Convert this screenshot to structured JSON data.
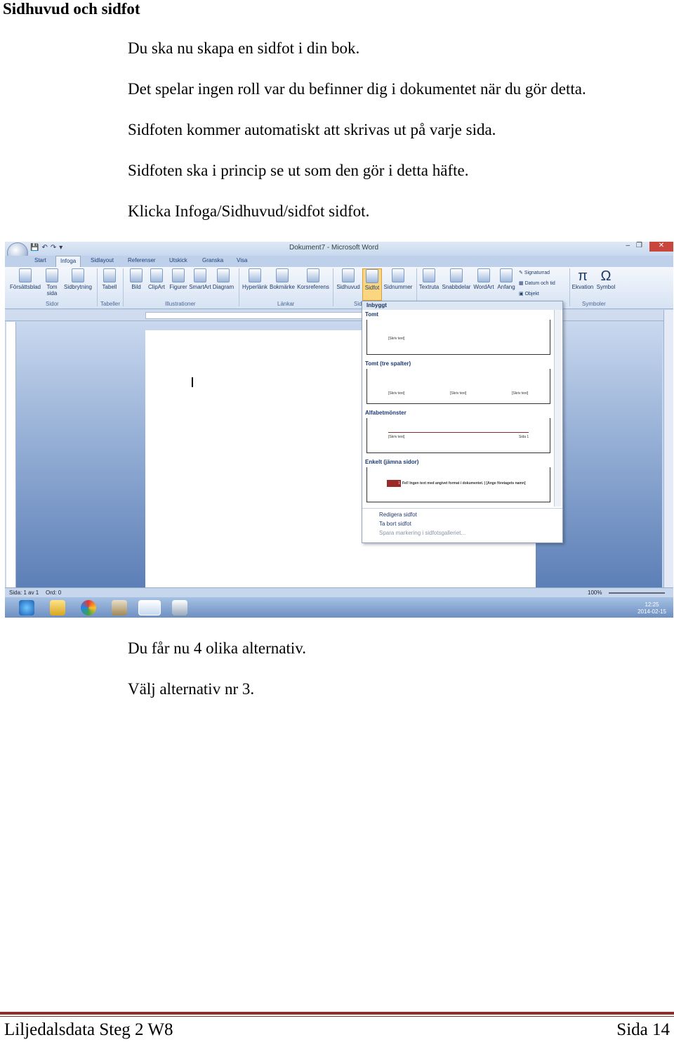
{
  "heading": "Sidhuvud och sidfot",
  "paragraphs_top": [
    "Du ska nu skapa en sidfot i din bok.",
    "Det spelar ingen roll var du befinner dig i dokumentet när du gör detta.",
    "Sidfoten kommer automatiskt att skrivas ut på varje sida.",
    "Sidfoten ska i princip se ut som den gör i detta häfte.",
    "Klicka Infoga/Sidhuvud/sidfot sidfot."
  ],
  "paragraphs_bottom": [
    "Du får nu 4 olika alternativ.",
    "Välj alternativ nr 3."
  ],
  "footer": {
    "left": "Liljedalsdata Steg 2 W8",
    "right": "Sida 14"
  },
  "word": {
    "window_title": "Dokument7 - Microsoft Word",
    "tabs": [
      "Start",
      "Infoga",
      "Sidlayout",
      "Referenser",
      "Utskick",
      "Granska",
      "Visa"
    ],
    "active_tab": "Infoga",
    "ribbon_buttons": [
      "Försättsblad",
      "Tom sida",
      "Sidbrytning",
      "Tabell",
      "Bild",
      "ClipArt",
      "Figurer",
      "SmartArt",
      "Diagram",
      "Hyperlänk",
      "Bokmärke",
      "Korsreferens",
      "Sidhuvud",
      "Sidfot",
      "Sidnummer",
      "Textruta",
      "Snabbdelar",
      "WordArt",
      "Anfang",
      "Ekvation",
      "Symbol"
    ],
    "ribbon_small": [
      "Signaturrad",
      "Datum och tid",
      "Objekt"
    ],
    "groups": [
      "Sidor",
      "Tabeller",
      "Illustrationer",
      "Länkar",
      "Sid",
      "Symboler"
    ],
    "gallery": {
      "header": "Inbyggt",
      "sections": [
        "Tomt",
        "Tomt (tre spalter)",
        "Alfabetmönster",
        "Enkelt (jämna sidor)"
      ],
      "placeholder": "[Skriv text]",
      "page_label": "Sida 1",
      "enkelt_text": "Fel! Ingen text med angivet format i dokumentet. | [Ange företagets namn]",
      "enkelt_num": "1",
      "menu": [
        "Redigera sidfot",
        "Ta bort sidfot",
        "Spara markering i sidfotsgalleriet..."
      ]
    },
    "status": {
      "page": "Sida: 1 av 1",
      "words": "Ord: 0",
      "zoom": "100%"
    },
    "clock": {
      "time": "12:25",
      "date": "2014-02-15"
    }
  }
}
